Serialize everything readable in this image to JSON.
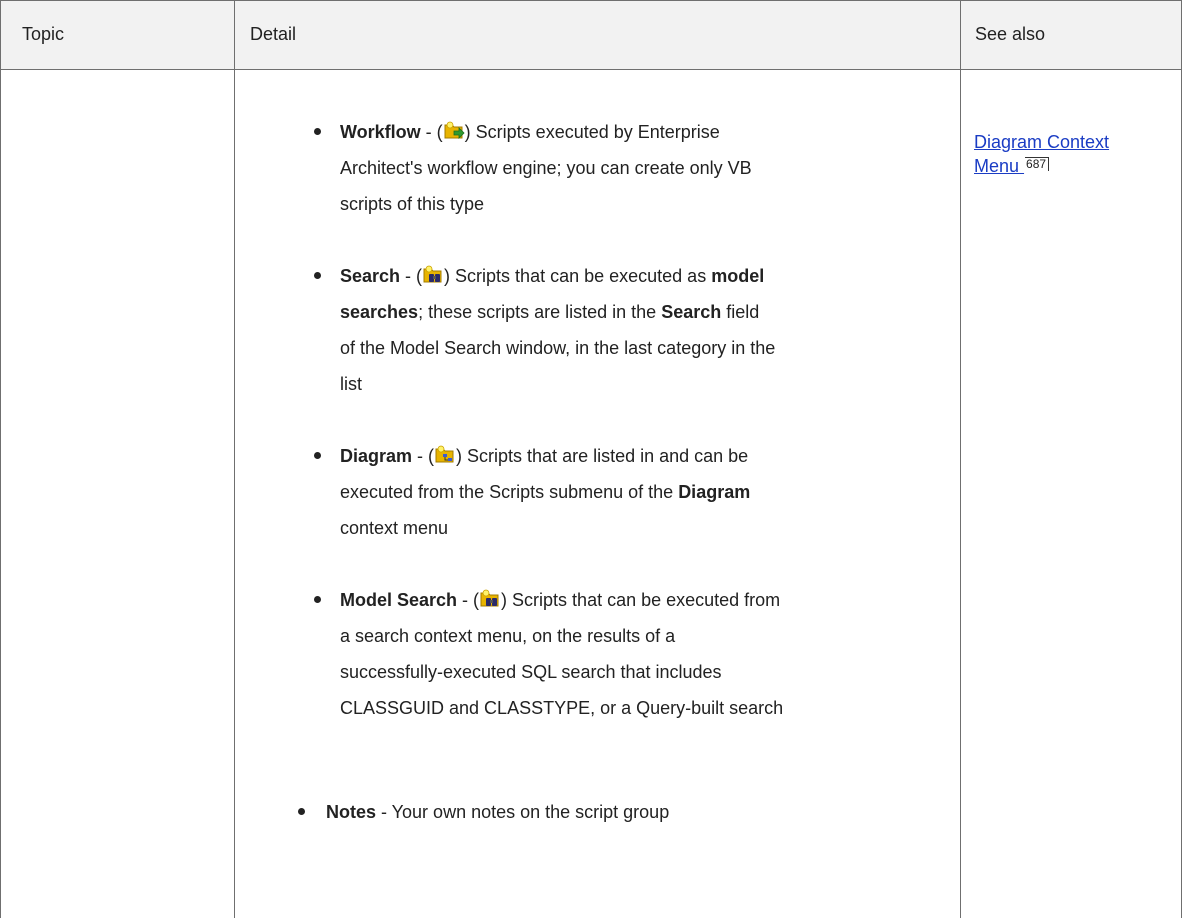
{
  "table": {
    "headers": {
      "topic": "Topic",
      "detail": "Detail",
      "see_also": "See also"
    }
  },
  "items": [
    {
      "name": "Workflow",
      "sep": " - (",
      "icon": "workflow-script-icon",
      "line1": ") Scripts executed by Enterprise",
      "rest": [
        "Architect's workflow engine; you can create only VB",
        "scripts of this type"
      ]
    },
    {
      "name": "Search",
      "sep": " - (",
      "icon": "search-script-icon",
      "line1a": ") Scripts that can be executed as ",
      "line1b": "model",
      "line2b": "searches",
      "line2c": "; these scripts are listed in the ",
      "line2d": "Search",
      "line2e": " field",
      "rest": [
        "of the Model Search window, in the last category in the",
        "list"
      ]
    },
    {
      "name": "Diagram",
      "sep": " - (",
      "icon": "diagram-script-icon",
      "line1": ") Scripts that are listed in and can be",
      "line2a": "executed from the Scripts submenu of the ",
      "line2b": "Diagram",
      "rest": [
        "context menu"
      ]
    },
    {
      "name": "Model Search",
      "sep": " - (",
      "icon": "model-search-script-icon",
      "line1": ") Scripts that can be executed from",
      "rest": [
        "a search context menu, on the results of a",
        "successfully-executed SQL search that includes",
        "CLASSGUID and CLASSTYPE, or a Query-built search"
      ]
    }
  ],
  "notes": {
    "name": "Notes",
    "text": " - Your own notes on the script group"
  },
  "see_also": {
    "link_line1": "Diagram Context",
    "link_line2": "Menu",
    "page": "687"
  },
  "colors": {
    "link": "#1a3cc4",
    "header_bg": "#f2f2f2",
    "rule": "#6f6f6f"
  }
}
